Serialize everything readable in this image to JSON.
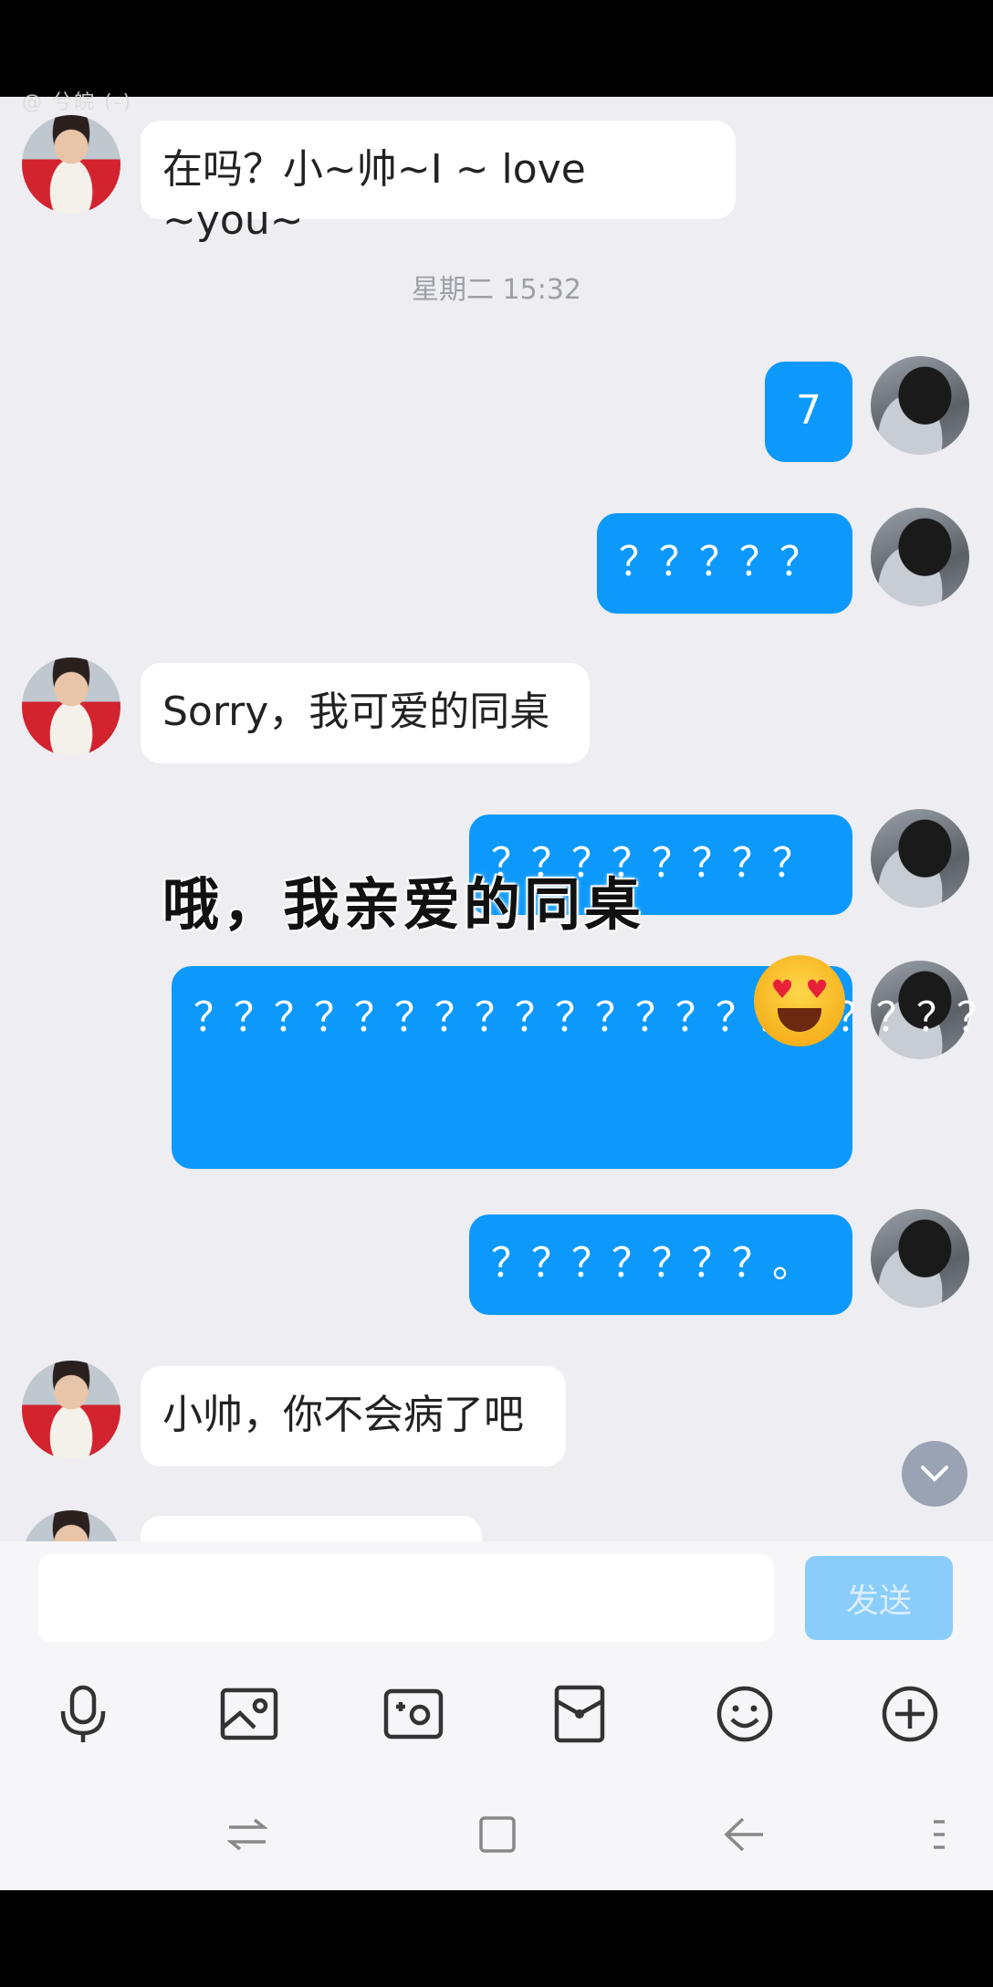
{
  "watermark": "@ 兮皖 (-)",
  "timestamp": "星期二 15:32",
  "messages": [
    {
      "text": "在吗？小~帅~I ~ love ~you~"
    },
    {
      "text": "7"
    },
    {
      "text": "？？？？？"
    },
    {
      "text": "Sorry，我可爱的同桌"
    },
    {
      "text": "？？？？？？？？"
    },
    {
      "text": "？？？？？？？？？？？？？？？？？？？？？？？？？？？？？？？？？？？？？？？？？？"
    },
    {
      "text": "？？？？？？？。"
    },
    {
      "text": "小帅，你不会病了吧"
    }
  ],
  "overlay_caption": "哦，我亲爱的同桌",
  "input": {
    "placeholder": ""
  },
  "send_label": "发送",
  "colors": {
    "outgoing_bubble": "#0d99fb",
    "incoming_bubble": "#ffffff",
    "chat_bg": "#ededf2",
    "send_disabled": "#8acdfb"
  },
  "icons": [
    "mic-icon",
    "image-icon",
    "camera-icon",
    "red-packet-icon",
    "emoji-icon",
    "plus-icon",
    "recent-apps-icon",
    "home-icon",
    "back-icon",
    "menu-icon"
  ]
}
